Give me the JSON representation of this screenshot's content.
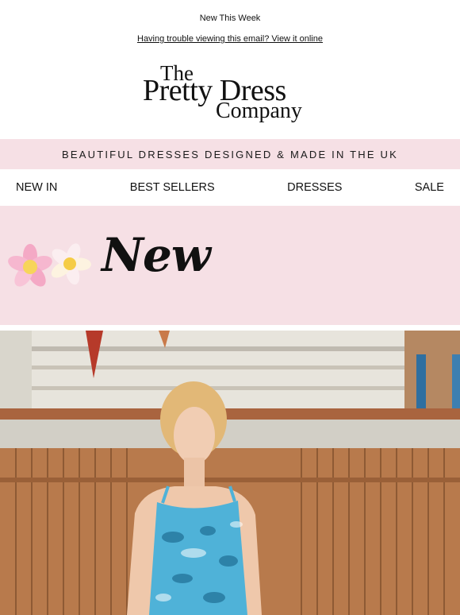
{
  "preheader": "New This Week",
  "view_online_text": "Having trouble viewing this email? View it online",
  "logo": {
    "line1": "The",
    "line2": "Pretty Dress",
    "line3": "Company"
  },
  "tagline": "BEAUTIFUL DRESSES DESIGNED & MADE IN THE UK",
  "nav": {
    "items": [
      {
        "label": "NEW IN"
      },
      {
        "label": "BEST SELLERS"
      },
      {
        "label": "DRESSES"
      },
      {
        "label": "SALE"
      }
    ]
  },
  "banner": {
    "heading": "New",
    "icon": "frangipani-flowers"
  },
  "colors": {
    "pink_bg": "#f6e0e5",
    "text": "#111111"
  },
  "hero": {
    "subject": "model-in-floral-print-dress-photo"
  }
}
